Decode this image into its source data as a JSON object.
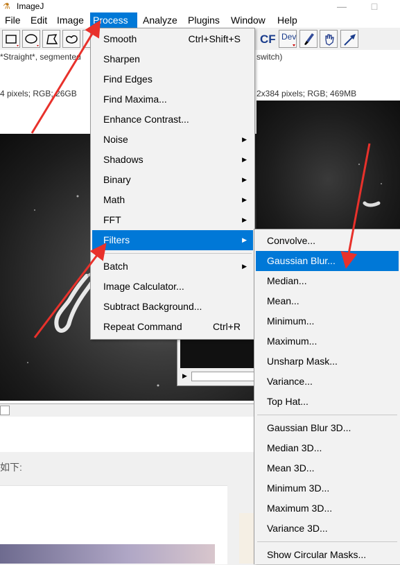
{
  "window": {
    "title": "ImageJ",
    "minimize": "—",
    "maximize": "□"
  },
  "menubar": [
    "File",
    "Edit",
    "Image",
    "Process",
    "Analyze",
    "Plugins",
    "Window",
    "Help"
  ],
  "toolbar": {
    "cf_label": "CF",
    "dev_label": "Dev"
  },
  "status": {
    "left": "*Straight*, segmented",
    "right": "switch)"
  },
  "image_windows": {
    "left_info": "4 pixels; RGB; 26GB",
    "right_info": "2x384 pixels; RGB; 469MB"
  },
  "page_text": "如下:",
  "process_menu": {
    "items": [
      {
        "label": "Smooth",
        "shortcut": "Ctrl+Shift+S"
      },
      {
        "label": "Sharpen"
      },
      {
        "label": "Find Edges"
      },
      {
        "label": "Find Maxima..."
      },
      {
        "label": "Enhance Contrast..."
      },
      {
        "label": "Noise",
        "submenu": true
      },
      {
        "label": "Shadows",
        "submenu": true
      },
      {
        "label": "Binary",
        "submenu": true
      },
      {
        "label": "Math",
        "submenu": true
      },
      {
        "label": "FFT",
        "submenu": true
      },
      {
        "label": "Filters",
        "submenu": true,
        "highlighted": true
      },
      {
        "label": "Batch",
        "submenu": true
      },
      {
        "label": "Image Calculator..."
      },
      {
        "label": "Subtract Background..."
      },
      {
        "label": "Repeat Command",
        "shortcut": "Ctrl+R"
      }
    ]
  },
  "filters_menu": {
    "items": [
      {
        "label": "Convolve..."
      },
      {
        "label": "Gaussian Blur...",
        "highlighted": true
      },
      {
        "label": "Median..."
      },
      {
        "label": "Mean..."
      },
      {
        "label": "Minimum..."
      },
      {
        "label": "Maximum..."
      },
      {
        "label": "Unsharp Mask..."
      },
      {
        "label": "Variance..."
      },
      {
        "label": "Top Hat..."
      },
      {
        "label": "Gaussian Blur 3D..."
      },
      {
        "label": "Median 3D..."
      },
      {
        "label": "Mean 3D..."
      },
      {
        "label": "Minimum 3D..."
      },
      {
        "label": "Maximum 3D..."
      },
      {
        "label": "Variance 3D..."
      },
      {
        "label": "Show Circular Masks..."
      }
    ]
  },
  "colors": {
    "highlight": "#0078d7",
    "annotation_arrow": "#e8312b",
    "menu_bg": "#f2f2f2"
  }
}
